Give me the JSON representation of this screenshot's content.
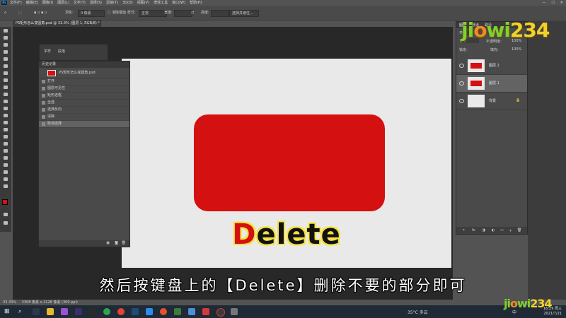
{
  "app": {
    "logo": "Ps",
    "menu": [
      "文件(F)",
      "编辑(E)",
      "图像(I)",
      "图层(L)",
      "文字(Y)",
      "选择(S)",
      "滤镜(T)",
      "3D(D)",
      "视图(V)",
      "增效工具",
      "窗口(W)",
      "帮助(H)"
    ],
    "window_controls": [
      "—",
      "☐",
      "✕"
    ]
  },
  "options": {
    "feather_label": "羽化:",
    "feather_value": "0 像素",
    "style_label": "样式:",
    "style_value": "正常",
    "width_label": "宽度:",
    "height_label": "高度:",
    "select_subject_button": "选择并遮住..."
  },
  "document": {
    "tab_title": "PS矩形怎么变圆角.psd @ 33.3% (图层 1, RGB/8) *",
    "canvas_word_first": "D",
    "canvas_word_rest": "elete"
  },
  "char_panel": {
    "tabs": [
      "字符",
      "段落"
    ]
  },
  "history": {
    "title": "历史记录",
    "snapshot": "PS矩形怎么变圆角.psd",
    "steps": [
      "打开",
      "图层可见性",
      "矩形选框",
      "全选",
      "选择反向",
      "清除",
      "取消选择"
    ],
    "selected_index": 6
  },
  "layers": {
    "title": "图层",
    "tabs": [
      "通道",
      "路径"
    ],
    "kind_label": "类型",
    "blend_mode": "正常",
    "opacity_label": "不透明度:",
    "opacity_value": "100%",
    "lock_label": "锁定:",
    "fill_label": "填充:",
    "fill_value": "100%",
    "items": [
      {
        "name": "图层 2",
        "selected": false
      },
      {
        "name": "图层 1",
        "selected": true
      },
      {
        "name": "背景",
        "selected": false
      }
    ]
  },
  "status": {
    "zoom": "33.33%",
    "doc_info": "3308 像素 x 2126 像素 (300 ppi)"
  },
  "subtitle": "然后按键盘上的【Delete】删除不要的部分即可",
  "watermark": {
    "part1": "ji",
    "part2": "o",
    "part3": "wi",
    "part4": "234"
  },
  "taskbar": {
    "weather": "35°C 多云",
    "time": "16:29 周三",
    "date": "2021/7/21",
    "language": "中"
  },
  "colors": {
    "accent_red": "#d41011",
    "highlight_yellow": "#f5e23a"
  }
}
